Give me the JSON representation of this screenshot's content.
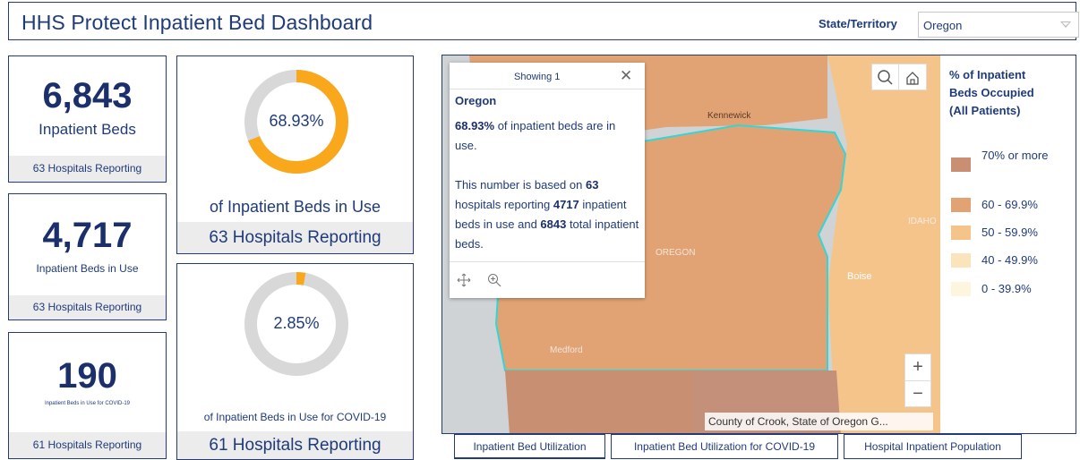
{
  "header": {
    "title": "HHS Protect Inpatient Bed Dashboard",
    "state_label": "State/Territory",
    "state_value": "Oregon"
  },
  "cards": {
    "inpatient_beds": {
      "value": "6,843",
      "label": "Inpatient Beds",
      "footer": "63 Hospitals Reporting"
    },
    "beds_in_use": {
      "value": "4,717",
      "label": "Inpatient Beds in Use",
      "footer": "63 Hospitals Reporting"
    },
    "covid_beds": {
      "value": "190",
      "label": "Inpatient Beds in Use for COVID-19",
      "footer": "61 Hospitals Reporting"
    }
  },
  "gauges": {
    "pct_in_use": {
      "value_text": "68.93%",
      "fraction": 0.6893,
      "label": "of Inpatient Beds in Use",
      "footer": "63 Hospitals Reporting",
      "color": "#f9a81c"
    },
    "pct_covid": {
      "value_text": "2.85%",
      "fraction": 0.0285,
      "label": "of Inpatient Beds in Use for COVID-19",
      "footer": "61 Hospitals Reporting",
      "color": "#f9a81c"
    }
  },
  "map": {
    "labels": {
      "kennewick": "Kennewick",
      "oregon": "OREGON",
      "idaho": "IDAHO",
      "boise": "Boise",
      "medford": "Medford"
    },
    "attribution": "County of Crook, State of Oregon G...",
    "popup": {
      "showing": "Showing 1",
      "name": "Oregon",
      "pct": "68.93%",
      "line1_rest": " of inpatient beds are in use.",
      "line2_a": "This number is based on ",
      "hospitals": "63",
      "line2_b": " hospitals reporting ",
      "beds_in_use": "4717",
      "line2_c": " inpatient beds in use and ",
      "total_beds": "6843",
      "line2_d": " total inpatient beds."
    },
    "zoom_in": "+",
    "zoom_out": "−"
  },
  "legend": {
    "title_line1": "% of Inpatient",
    "title_line2": "Beds Occupied",
    "title_line3": "(All Patients)",
    "items": [
      {
        "label": "70% or more",
        "color": "#c88f72"
      },
      {
        "label": "60 - 69.9%",
        "color": "#e2a374"
      },
      {
        "label": "50 - 59.9%",
        "color": "#f4c48b"
      },
      {
        "label": "40 - 49.9%",
        "color": "#fbe3bc"
      },
      {
        "label": "0 - 39.9%",
        "color": "#fdf5dd"
      }
    ]
  },
  "tabs": [
    {
      "label": "Inpatient Bed Utilization"
    },
    {
      "label": "Inpatient Bed Utilization for COVID-19"
    },
    {
      "label": "Hospital Inpatient Population"
    }
  ]
}
